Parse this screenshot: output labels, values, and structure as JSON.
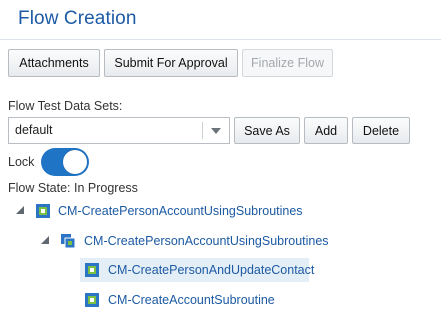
{
  "header": {
    "title": "Flow Creation"
  },
  "toolbar": {
    "attachments_label": "Attachments",
    "submit_label": "Submit For Approval",
    "finalize_label": "Finalize Flow"
  },
  "data_sets": {
    "label": "Flow Test Data Sets:",
    "selected": "default",
    "save_as_label": "Save As",
    "add_label": "Add",
    "delete_label": "Delete"
  },
  "lock": {
    "label": "Lock",
    "enabled": true
  },
  "flow_state": {
    "text": "Flow State: In Progress"
  },
  "tree": {
    "root": "CM-CreatePersonAccountUsingSubroutines",
    "child": "CM-CreatePersonAccountUsingSubroutines",
    "leaf1": "CM-CreatePersonAndUpdateContact",
    "leaf2": "CM-CreateAccountSubroutine"
  },
  "colors": {
    "accent": "#1f74c5",
    "title": "#1d5aa6",
    "link": "#1c5aa3",
    "selected_row": "#e4eef7"
  }
}
